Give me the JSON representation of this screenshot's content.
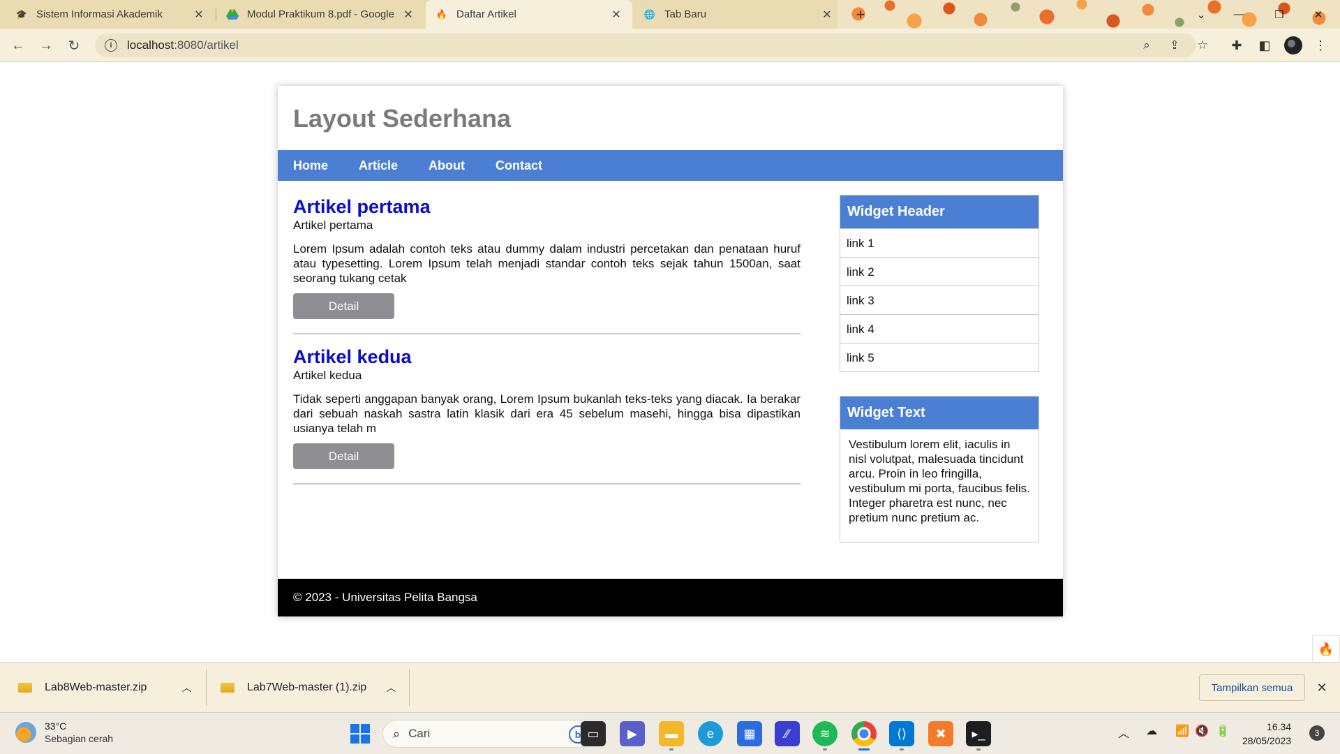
{
  "browser": {
    "tabs": [
      {
        "title": "Sistem Informasi Akademik",
        "icon": "university-icon"
      },
      {
        "title": "Modul Praktikum 8.pdf - Google",
        "icon": "google-drive-icon"
      },
      {
        "title": "Daftar Artikel",
        "icon": "codeigniter-icon"
      },
      {
        "title": "Tab Baru",
        "icon": "globe-icon"
      }
    ],
    "active_tab": 2,
    "url_host": "localhost",
    "url_rest": ":8080/artikel"
  },
  "page": {
    "title": "Layout Sederhana",
    "nav": [
      "Home",
      "Article",
      "About",
      "Contact"
    ],
    "articles": [
      {
        "title": "Artikel pertama",
        "image_alt": "Artikel pertama",
        "body": "Lorem Ipsum adalah contoh teks atau dummy dalam industri percetakan dan penataan huruf atau typesetting. Lorem Ipsum telah menjadi standar contoh teks sejak tahun 1500an, saat seorang tukang cetak",
        "button": "Detail"
      },
      {
        "title": "Artikel kedua",
        "image_alt": "Artikel kedua",
        "body": "Tidak seperti anggapan banyak orang, Lorem Ipsum bukanlah teks-teks yang diacak. Ia berakar dari sebuah naskah sastra latin klasik dari era 45 sebelum masehi, hingga bisa dipastikan usianya telah m",
        "button": "Detail"
      }
    ],
    "widget_links": {
      "header": "Widget Header",
      "links": [
        "link 1",
        "link 2",
        "link 3",
        "link 4",
        "link 5"
      ]
    },
    "widget_text": {
      "header": "Widget Text",
      "body": "Vestibulum lorem elit, iaculis in nisl volutpat, malesuada tincidunt arcu. Proin in leo fringilla, vestibulum mi porta, faucibus felis. Integer pharetra est nunc, nec pretium nunc pretium ac."
    },
    "footer": "© 2023 - Universitas Pelita Bangsa"
  },
  "downloads": {
    "items": [
      "Lab8Web-master.zip",
      "Lab7Web-master (1).zip"
    ],
    "show_all": "Tampilkan semua"
  },
  "taskbar": {
    "weather_temp": "33°C",
    "weather_desc": "Sebagian cerah",
    "search_placeholder": "Cari",
    "time": "16.34",
    "date": "28/05/2023",
    "notifications": "3"
  },
  "colors": {
    "nav_blue": "#4a7fd4",
    "article_title": "#0a0dcc",
    "button_gray": "#8e8e93",
    "footer_black": "#000000"
  }
}
